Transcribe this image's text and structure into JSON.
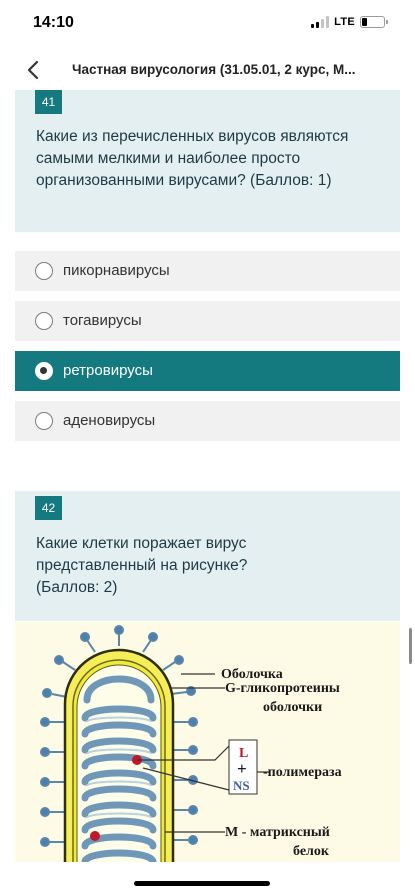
{
  "status_bar": {
    "time": "14:10",
    "network": "LTE",
    "battery_level": 0.22
  },
  "nav": {
    "back_icon": "chevron-left-icon",
    "title": "Частная вирусология (31.05.01, 2 курс, М..."
  },
  "questions": [
    {
      "number": "41",
      "text": "Какие из перечисленных вирусов являются самыми мелкими и наиболее просто организованными вирусами?",
      "points": "(Баллов: 1)",
      "options": [
        {
          "label": "пикорнавирусы",
          "selected": false
        },
        {
          "label": "тогавирусы",
          "selected": false
        },
        {
          "label": "ретровирусы",
          "selected": true
        },
        {
          "label": "аденовирусы",
          "selected": false
        }
      ]
    },
    {
      "number": "42",
      "text": "Какие клетки поражает вирус представленный на рисунке?",
      "points": "(Баллов: 2)",
      "figure": {
        "labels": {
          "envelope": "Оболочка",
          "glyco_1": "G-гликопротеины",
          "glyco_2": "оболочки",
          "pol_L": "L",
          "pol_plus": "+",
          "pol_NS": "NS",
          "polymerase": "-полимераза",
          "matrix_1": "M - матриксный",
          "matrix_2": "белок"
        }
      }
    }
  ],
  "colors": {
    "accent": "#147a80",
    "card_bg": "#e3eff1",
    "option_bg": "#f1f1f1"
  }
}
